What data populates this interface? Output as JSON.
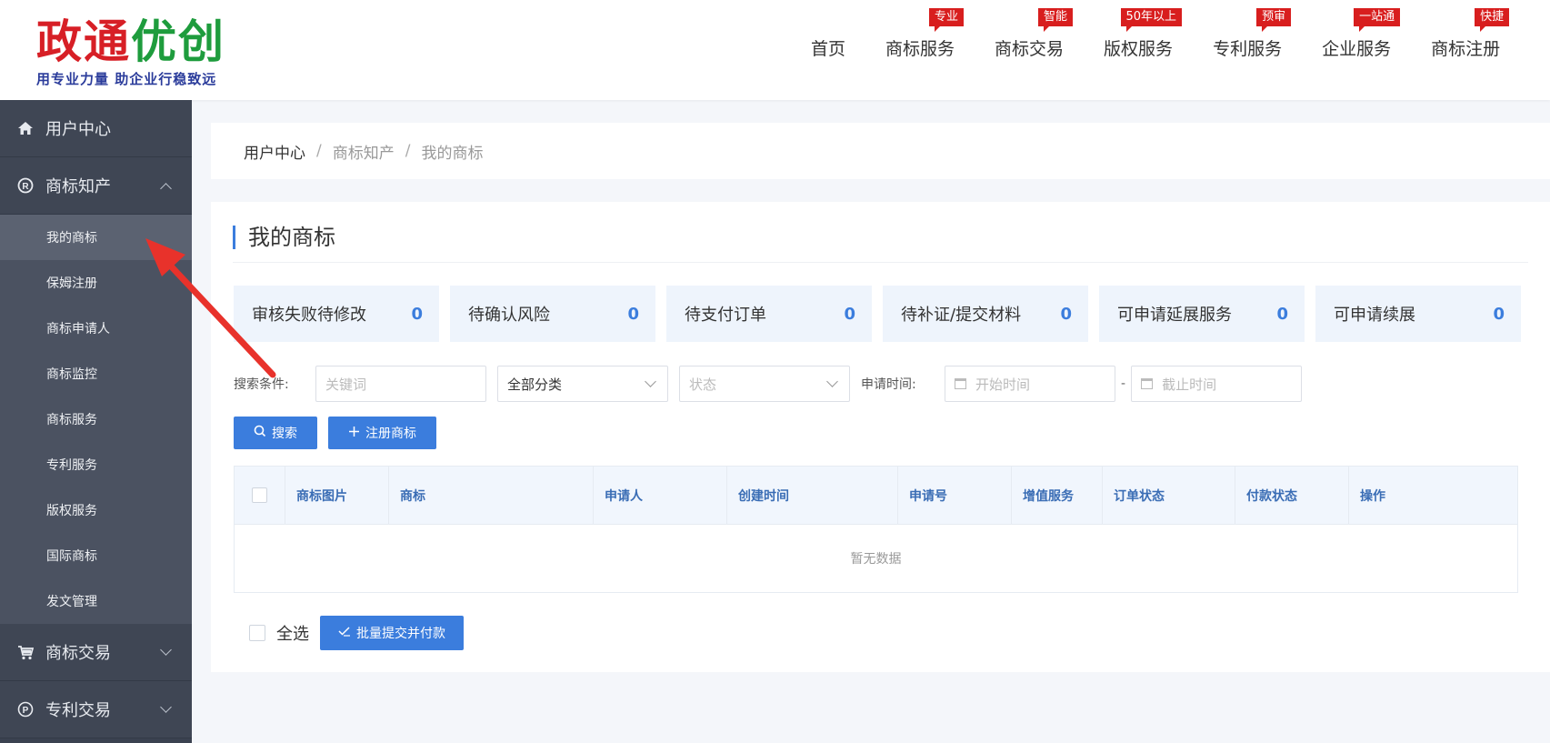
{
  "logo": {
    "part1": "政通",
    "part2": "优创",
    "tagline": "用专业力量 助企业行稳致远"
  },
  "nav": [
    {
      "label": "首页",
      "badge": ""
    },
    {
      "label": "商标服务",
      "badge": "专业"
    },
    {
      "label": "商标交易",
      "badge": "智能"
    },
    {
      "label": "版权服务",
      "badge": "50年以上"
    },
    {
      "label": "专利服务",
      "badge": "预审"
    },
    {
      "label": "企业服务",
      "badge": "一站通"
    },
    {
      "label": "商标注册",
      "badge": "快捷"
    }
  ],
  "sidebar": {
    "user_center": "用户中心",
    "trademark_ip": "商标知产",
    "items": [
      "我的商标",
      "保姆注册",
      "商标申请人",
      "商标监控",
      "商标服务",
      "专利服务",
      "版权服务",
      "国际商标",
      "发文管理"
    ],
    "trademark_trade": "商标交易",
    "patent_trade": "专利交易"
  },
  "breadcrumb": {
    "root": "用户中心",
    "section": "商标知产",
    "current": "我的商标",
    "sep": "/"
  },
  "page": {
    "title": "我的商标"
  },
  "stats": [
    {
      "label": "审核失败待修改",
      "count": "0"
    },
    {
      "label": "待确认风险",
      "count": "0"
    },
    {
      "label": "待支付订单",
      "count": "0"
    },
    {
      "label": "待补证/提交材料",
      "count": "0"
    },
    {
      "label": "可申请延展服务",
      "count": "0"
    },
    {
      "label": "可申请续展",
      "count": "0"
    }
  ],
  "filters": {
    "label": "搜索条件:",
    "keyword_placeholder": "关键词",
    "category_value": "全部分类",
    "status_placeholder": "状态",
    "time_label": "申请时间:",
    "start_placeholder": "开始时间",
    "dash": "-",
    "end_placeholder": "截止时间"
  },
  "buttons": {
    "search": "搜索",
    "register": "注册商标",
    "batch": "批量提交并付款"
  },
  "table": {
    "columns": [
      "商标图片",
      "商标",
      "申请人",
      "创建时间",
      "申请号",
      "增值服务",
      "订单状态",
      "付款状态",
      "操作"
    ],
    "empty": "暂无数据"
  },
  "footer": {
    "select_all": "全选"
  },
  "colors": {
    "accent": "#3b7ddd",
    "sidebar_bg": "#3b4250",
    "badge_red": "#d81e1e",
    "arrow_red": "#e8322b"
  }
}
